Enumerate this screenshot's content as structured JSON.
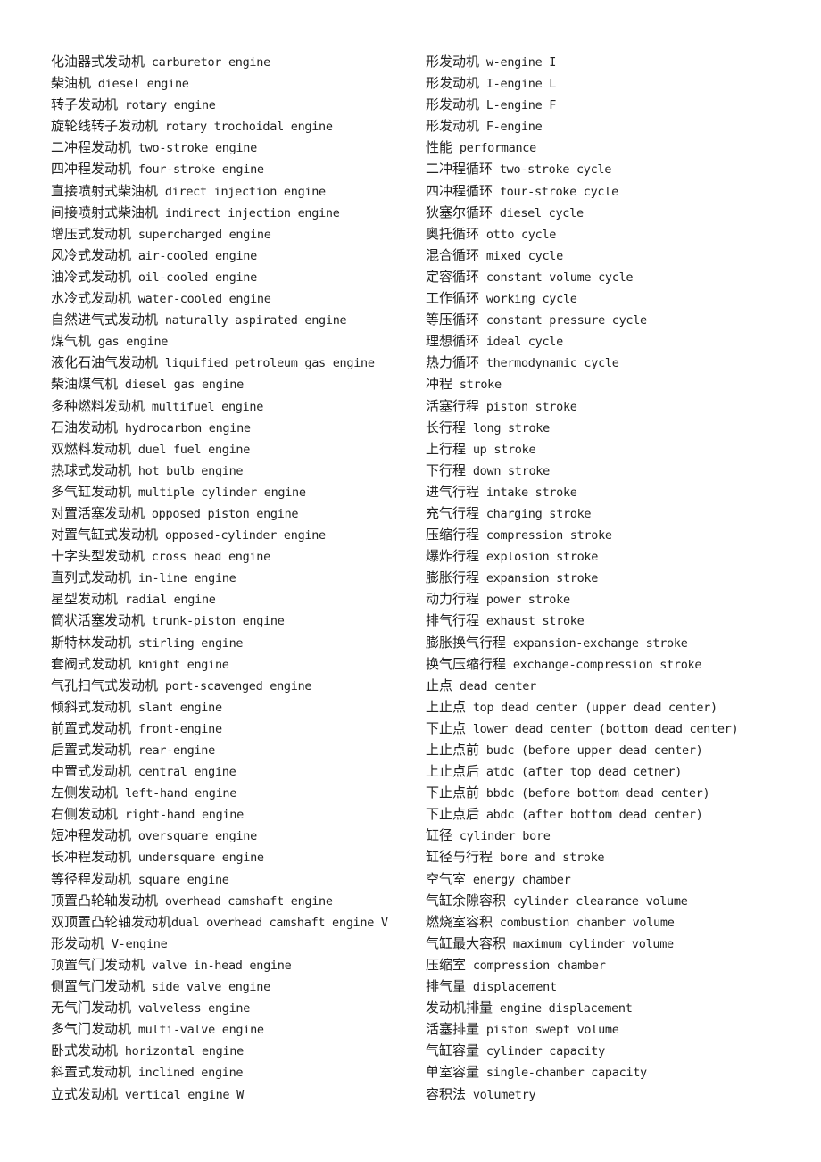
{
  "document": {
    "left_column": [
      {
        "zh": "化油器式发动机",
        "en": " carburetor engine"
      },
      {
        "zh": "柴油机",
        "en": " diesel engine"
      },
      {
        "zh": "转子发动机",
        "en": " rotary engine"
      },
      {
        "zh": "旋轮线转子发动机",
        "en": " rotary trochoidal engine"
      },
      {
        "zh": "二冲程发动机",
        "en": " two-stroke engine"
      },
      {
        "zh": "四冲程发动机",
        "en": " four-stroke engine"
      },
      {
        "zh": "直接喷射式柴油机",
        "en": " direct injection engine"
      },
      {
        "zh": "间接喷射式柴油机",
        "en": " indirect injection engine"
      },
      {
        "zh": "增压式发动机",
        "en": " supercharged engine"
      },
      {
        "zh": "风冷式发动机",
        "en": " air-cooled engine"
      },
      {
        "zh": "油冷式发动机",
        "en": " oil-cooled engine"
      },
      {
        "zh": "水冷式发动机",
        "en": " water-cooled engine"
      },
      {
        "zh": "自然进气式发动机",
        "en": " naturally aspirated engine"
      },
      {
        "zh": "煤气机",
        "en": " gas engine"
      },
      {
        "zh": "液化石油气发动机",
        "en": " liquified petroleum gas engine"
      },
      {
        "zh": "柴油煤气机",
        "en": " diesel gas engine"
      },
      {
        "zh": "多种燃料发动机",
        "en": " multifuel engine"
      },
      {
        "zh": "石油发动机",
        "en": " hydrocarbon engine"
      },
      {
        "zh": "双燃料发动机",
        "en": " duel fuel engine"
      },
      {
        "zh": "热球式发动机",
        "en": " hot bulb engine"
      },
      {
        "zh": "多气缸发动机",
        "en": " multiple cylinder engine"
      },
      {
        "zh": "对置活塞发动机",
        "en": " opposed piston engine"
      },
      {
        "zh": "对置气缸式发动机",
        "en": " opposed-cylinder engine"
      },
      {
        "zh": "十字头型发动机",
        "en": " cross head engine"
      },
      {
        "zh": "直列式发动机",
        "en": " in-line engine"
      },
      {
        "zh": "星型发动机",
        "en": " radial engine"
      },
      {
        "zh": "筒状活塞发动机",
        "en": " trunk-piston engine"
      },
      {
        "zh": "斯特林发动机",
        "en": " stirling engine"
      },
      {
        "zh": "套阀式发动机",
        "en": " knight engine"
      },
      {
        "zh": "气孔扫气式发动机",
        "en": " port-scavenged engine"
      },
      {
        "zh": "倾斜式发动机",
        "en": " slant engine"
      },
      {
        "zh": "前置式发动机",
        "en": " front-engine"
      },
      {
        "zh": "后置式发动机",
        "en": " rear-engine"
      },
      {
        "zh": "中置式发动机",
        "en": " central engine"
      },
      {
        "zh": "左侧发动机",
        "en": " left-hand engine"
      },
      {
        "zh": "右侧发动机",
        "en": " right-hand engine"
      },
      {
        "zh": "短冲程发动机",
        "en": " oversquare engine"
      },
      {
        "zh": "长冲程发动机",
        "en": " undersquare engine"
      },
      {
        "zh": "等径程发动机",
        "en": " square engine"
      },
      {
        "zh": "顶置凸轮轴发动机",
        "en": " overhead camshaft engine"
      },
      {
        "zh": "双顶置凸轮轴发动机",
        "en": "dual overhead camshaft engine V"
      },
      {
        "zh": "形发动机",
        "en": " V-engine"
      },
      {
        "zh": "顶置气门发动机",
        "en": " valve in-head engine"
      },
      {
        "zh": "侧置气门发动机",
        "en": " side valve engine"
      },
      {
        "zh": "无气门发动机",
        "en": " valveless engine"
      },
      {
        "zh": "多气门发动机",
        "en": " multi-valve engine"
      },
      {
        "zh": "卧式发动机",
        "en": " horizontal engine"
      },
      {
        "zh": "斜置式发动机",
        "en": " inclined engine"
      },
      {
        "zh": "立式发动机",
        "en": " vertical engine W"
      }
    ],
    "right_column": [
      {
        "zh": "形发动机",
        "en": " w-engine I"
      },
      {
        "zh": "形发动机",
        "en": " I-engine L"
      },
      {
        "zh": "形发动机",
        "en": " L-engine F"
      },
      {
        "zh": "形发动机",
        "en": " F-engine"
      },
      {
        "zh": "性能",
        "en": " performance"
      },
      {
        "zh": "二冲程循环",
        "en": " two-stroke cycle"
      },
      {
        "zh": "四冲程循环",
        "en": " four-stroke cycle"
      },
      {
        "zh": "狄塞尔循环",
        "en": " diesel cycle"
      },
      {
        "zh": "奥托循环",
        "en": " otto cycle"
      },
      {
        "zh": "混合循环",
        "en": " mixed cycle"
      },
      {
        "zh": "定容循环",
        "en": " constant volume cycle"
      },
      {
        "zh": "工作循环",
        "en": " working cycle"
      },
      {
        "zh": "等压循环",
        "en": " constant pressure cycle"
      },
      {
        "zh": "理想循环",
        "en": " ideal cycle"
      },
      {
        "zh": "热力循环",
        "en": " thermodynamic cycle"
      },
      {
        "zh": "冲程",
        "en": " stroke"
      },
      {
        "zh": "活塞行程",
        "en": " piston stroke"
      },
      {
        "zh": "长行程",
        "en": " long stroke"
      },
      {
        "zh": "上行程",
        "en": " up stroke"
      },
      {
        "zh": "下行程",
        "en": " down stroke"
      },
      {
        "zh": "进气行程",
        "en": " intake stroke"
      },
      {
        "zh": "充气行程",
        "en": " charging stroke"
      },
      {
        "zh": "压缩行程",
        "en": " compression stroke"
      },
      {
        "zh": "爆炸行程",
        "en": " explosion stroke"
      },
      {
        "zh": "膨胀行程",
        "en": " expansion stroke"
      },
      {
        "zh": "动力行程",
        "en": " power stroke"
      },
      {
        "zh": "排气行程",
        "en": " exhaust stroke"
      },
      {
        "zh": "膨胀换气行程",
        "en": " expansion-exchange stroke"
      },
      {
        "zh": "换气压缩行程",
        "en": " exchange-compression stroke"
      },
      {
        "zh": "止点",
        "en": " dead center"
      },
      {
        "zh": "上止点",
        "en": " top dead center (upper dead center)"
      },
      {
        "zh": "下止点",
        "en": " lower dead center (bottom dead center)"
      },
      {
        "zh": "上止点前",
        "en": " budc (before upper dead center)"
      },
      {
        "zh": "上止点后",
        "en": " atdc (after top dead cetner)"
      },
      {
        "zh": "下止点前",
        "en": " bbdc (before bottom dead center)"
      },
      {
        "zh": "下止点后",
        "en": " abdc (after bottom dead center)"
      },
      {
        "zh": "缸径",
        "en": " cylinder bore"
      },
      {
        "zh": "缸径与行程",
        "en": " bore and stroke"
      },
      {
        "zh": "空气室",
        "en": " energy chamber"
      },
      {
        "zh": "气缸余隙容积",
        "en": " cylinder clearance volume"
      },
      {
        "zh": "燃烧室容积",
        "en": " combustion chamber volume"
      },
      {
        "zh": "气缸最大容积",
        "en": " maximum cylinder volume"
      },
      {
        "zh": "压缩室",
        "en": " compression chamber"
      },
      {
        "zh": "排气量",
        "en": " displacement"
      },
      {
        "zh": "发动机排量",
        "en": " engine displacement"
      },
      {
        "zh": "活塞排量",
        "en": " piston swept volume"
      },
      {
        "zh": "气缸容量",
        "en": " cylinder capacity"
      },
      {
        "zh": "单室容量",
        "en": " single-chamber capacity"
      },
      {
        "zh": "容积法",
        "en": " volumetry"
      }
    ]
  }
}
